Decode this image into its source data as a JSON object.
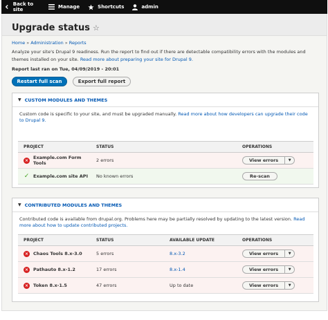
{
  "toolbar": {
    "back_label": "Back to site",
    "manage_label": "Manage",
    "shortcuts_label": "Shortcuts",
    "user_label": "admin"
  },
  "page": {
    "title": "Upgrade status",
    "breadcrumb": [
      "Home",
      "Administration",
      "Reports"
    ],
    "intro_text": "Analyze your site's Drupal 9 readiness. Run the report to find out if there are detectable compatibility errors with the modules and themes installed on your site.",
    "intro_link": "Read more about preparing your site for Drupal 9.",
    "last_run": "Report last ran on Tue, 04/09/2019 - 20:01",
    "restart_button": "Restart full scan",
    "export_button": "Export full report"
  },
  "custom_section": {
    "heading": "CUSTOM MODULES AND THEMES",
    "description": "Custom code is specific to your site, and must be upgraded manually.",
    "description_link": "Read more about how developers can upgrade their code to Drupal 9.",
    "columns": [
      "PROJECT",
      "STATUS",
      "OPERATIONS"
    ],
    "rows": [
      {
        "project": "Example.com Form Tools",
        "status": "2 errors",
        "operation": "View errors",
        "state": "error"
      },
      {
        "project": "Example.com site API",
        "status": "No known errors",
        "operation": "Re-scan",
        "state": "ok"
      }
    ]
  },
  "contrib_section": {
    "heading": "CONTRIBUTED MODULES AND THEMES",
    "description": "Contributed code is available from drupal.org. Problems here may be partially resolved by updating to the latest version.",
    "description_link": "Read more about how to update contributed projects.",
    "columns": [
      "PROJECT",
      "STATUS",
      "AVAILABLE UPDATE",
      "OPERATIONS"
    ],
    "rows": [
      {
        "project": "Chaos Tools 8.x-3.0",
        "status": "5 errors",
        "update": "8.x-3.2",
        "operation": "View errors"
      },
      {
        "project": "Pathauto 8.x-1.2",
        "status": "17 errors",
        "update": "8.x-1.4",
        "operation": "View errors"
      },
      {
        "project": "Token 8.x-1.5",
        "status": "47 errors",
        "update": "Up to date",
        "operation": "View errors"
      }
    ]
  },
  "colors": {
    "accent": "#0071b8",
    "link": "#0057b3",
    "error": "#d72222",
    "ok": "#42a21f",
    "toolbar": "#0f0f0f"
  },
  "icons": {
    "back": "back-arrow-icon",
    "manage": "hamburger-menu-icon",
    "shortcuts": "star-icon",
    "user": "user-icon",
    "error": "error-x-icon",
    "ok": "checkmark-icon"
  }
}
